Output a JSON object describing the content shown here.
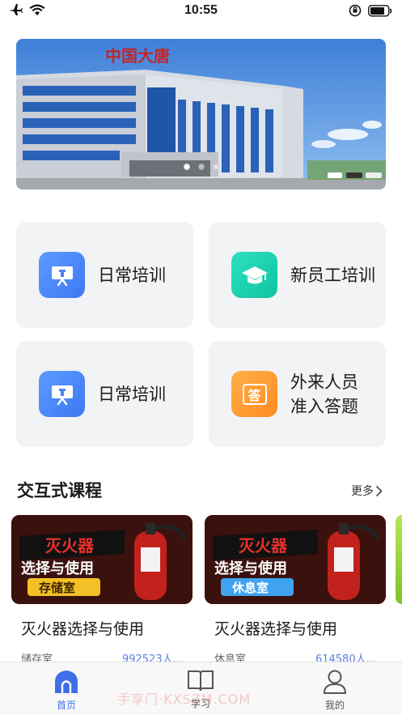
{
  "status_bar": {
    "time": "10:55"
  },
  "banner": {
    "sign_text": "中国大唐",
    "slide_count": 3,
    "active_slide": 0
  },
  "menu": [
    {
      "label": "日常培训",
      "icon": "training-board-icon",
      "icon_glyph": "",
      "color": "#4a85f7"
    },
    {
      "label": "新员工培训",
      "icon": "graduation-cap-icon",
      "icon_glyph": "",
      "color": "#1ccfae"
    },
    {
      "label": "日常培训",
      "icon": "training-board-icon",
      "icon_glyph": "",
      "color": "#4a85f7"
    },
    {
      "label": "外来人员\n准入答题",
      "icon": "answer-bubble-icon",
      "icon_glyph": "答",
      "color": "#ff9a30"
    }
  ],
  "section": {
    "title": "交互式课程",
    "more_label": "更多"
  },
  "courses": [
    {
      "title": "灭火器选择与使用",
      "location": "储存室",
      "count": "992523人...",
      "thumb_title": "灭火器",
      "thumb_sub": "选择与使用",
      "thumb_tag": "存储室"
    },
    {
      "title": "灭火器选择与使用",
      "location": "休息室",
      "count": "614580人...",
      "thumb_title": "灭火器",
      "thumb_sub": "选择与使用",
      "thumb_tag": "休息室"
    }
  ],
  "tabbar": [
    {
      "label": "首页",
      "icon": "home-icon",
      "active": true
    },
    {
      "label": "学习",
      "icon": "book-icon",
      "active": false
    },
    {
      "label": "我的",
      "icon": "profile-icon",
      "active": false
    }
  ],
  "watermark": "手享门·KXSZM.COM"
}
